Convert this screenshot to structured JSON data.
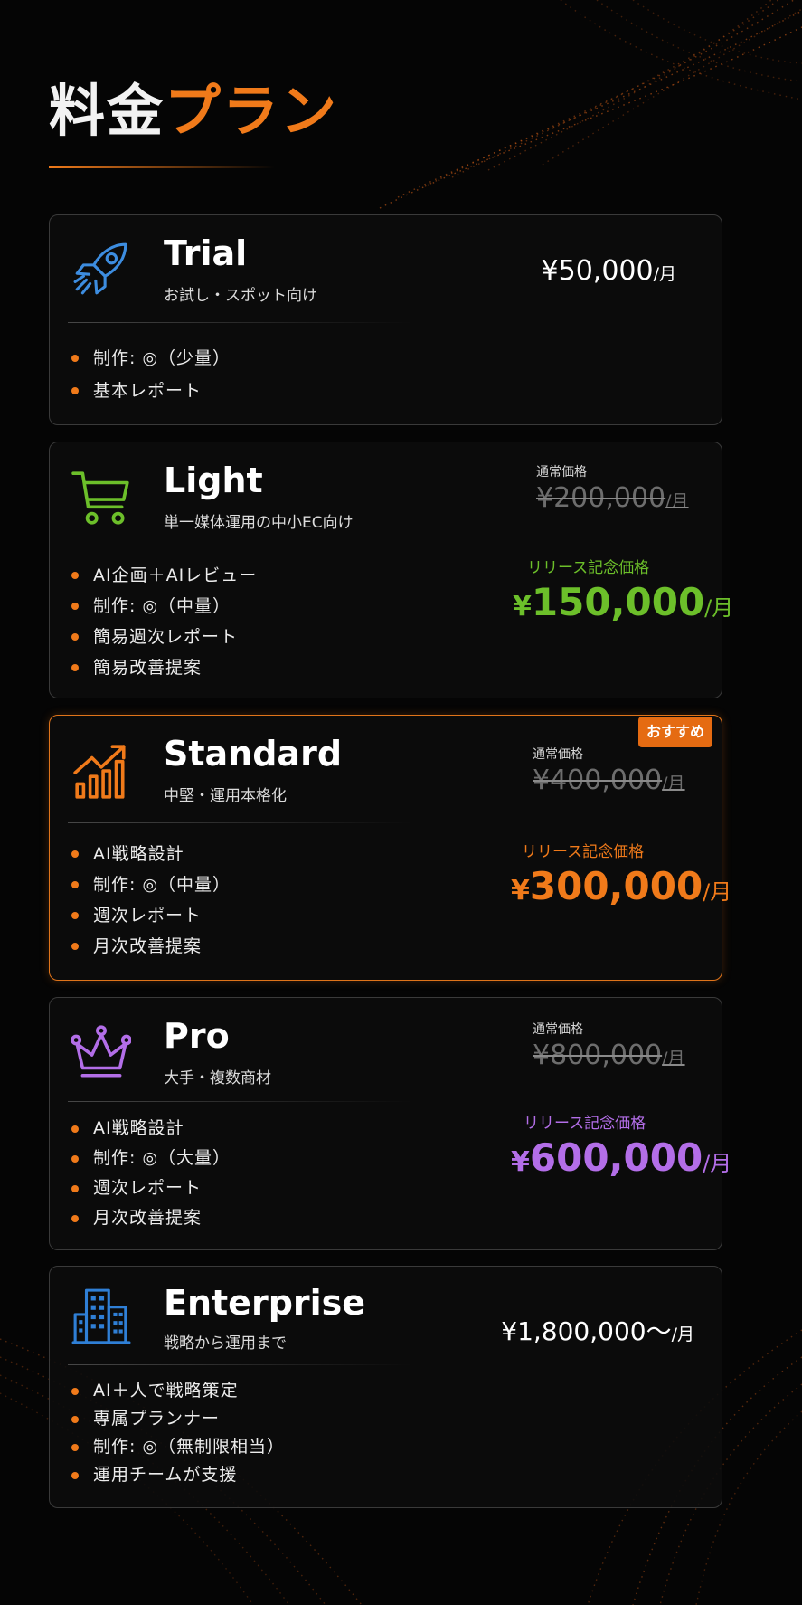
{
  "title": {
    "part1": "料金",
    "part2": "プラン"
  },
  "colors": {
    "accent": "#f07a1a",
    "light": "#6cbf2a",
    "standard": "#f07a1a",
    "pro": "#b36ee8",
    "trial_icon": "#3d8de0",
    "enterprise_icon": "#2f7fd6"
  },
  "plans": [
    {
      "name": "Trial",
      "subtitle": "お試し・スポット向け",
      "icon": "rocket-icon",
      "features": [
        "制作: ◎（少量）",
        "基本レポート"
      ],
      "price": {
        "amount": "¥50,000",
        "unit": "/月"
      }
    },
    {
      "name": "Light",
      "subtitle": "単一媒体運用の中小EC向け",
      "icon": "shopping-cart-icon",
      "features": [
        "AI企画＋AIレビュー",
        "制作: ◎（中量）",
        "簡易週次レポート",
        "簡易改善提案"
      ],
      "regular_label": "通常価格",
      "regular_price": {
        "amount": "¥200,000",
        "unit": "/月"
      },
      "promo_label": "リリース記念価格",
      "promo_price": {
        "yen": "¥",
        "amount": "150,000",
        "unit": "/月"
      }
    },
    {
      "name": "Standard",
      "subtitle": "中堅・運用本格化",
      "icon": "growth-chart-icon",
      "badge": "おすすめ",
      "features": [
        "AI戦略設計",
        "制作: ◎（中量）",
        "週次レポート",
        "月次改善提案"
      ],
      "regular_label": "通常価格",
      "regular_price": {
        "amount": "¥400,000",
        "unit": "/月"
      },
      "promo_label": "リリース記念価格",
      "promo_price": {
        "yen": "¥",
        "amount": "300,000",
        "unit": "/月"
      }
    },
    {
      "name": "Pro",
      "subtitle": "大手・複数商材",
      "icon": "crown-icon",
      "features": [
        "AI戦略設計",
        "制作: ◎（大量）",
        "週次レポート",
        "月次改善提案"
      ],
      "regular_label": "通常価格",
      "regular_price": {
        "amount": "¥800,000",
        "unit": "/月"
      },
      "promo_label": "リリース記念価格",
      "promo_price": {
        "yen": "¥",
        "amount": "600,000",
        "unit": "/月"
      }
    },
    {
      "name": "Enterprise",
      "subtitle": "戦略から運用まで",
      "icon": "office-building-icon",
      "features": [
        "AI＋人で戦略策定",
        "専属プランナー",
        "制作: ◎（無制限相当）",
        "運用チームが支援"
      ],
      "price": {
        "amount": "¥1,800,000～",
        "unit": "/月"
      }
    }
  ]
}
